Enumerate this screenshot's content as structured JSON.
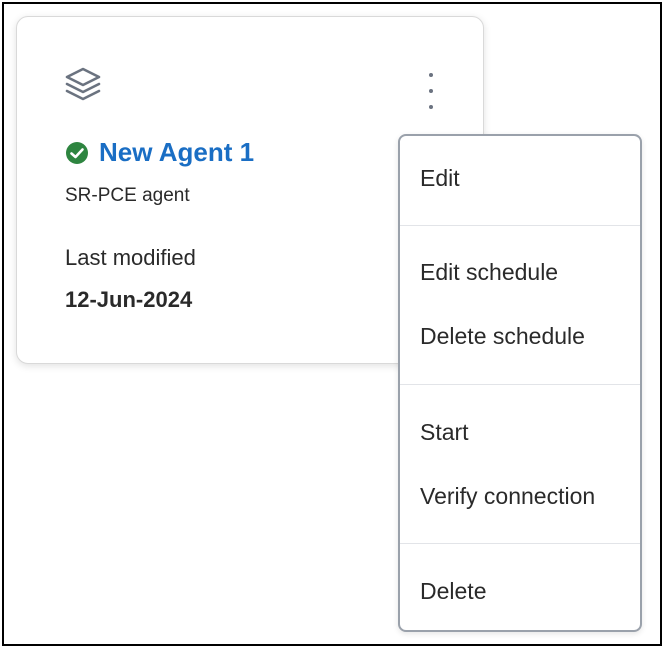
{
  "card": {
    "icon": "layers-icon",
    "menu_icon": "kebab-menu-icon",
    "status_icon": "check-circle-icon",
    "status_color": "#2e8540",
    "name": "New Agent 1",
    "name_color": "#1a6ec4",
    "type": "SR-PCE agent",
    "modified_label": "Last modified",
    "modified_value": "12-Jun-2024"
  },
  "menu": {
    "items": [
      {
        "label": "Edit"
      },
      {
        "label": "Edit schedule"
      },
      {
        "label": "Delete schedule"
      },
      {
        "label": "Start"
      },
      {
        "label": "Verify connection"
      },
      {
        "label": "Delete"
      }
    ]
  }
}
